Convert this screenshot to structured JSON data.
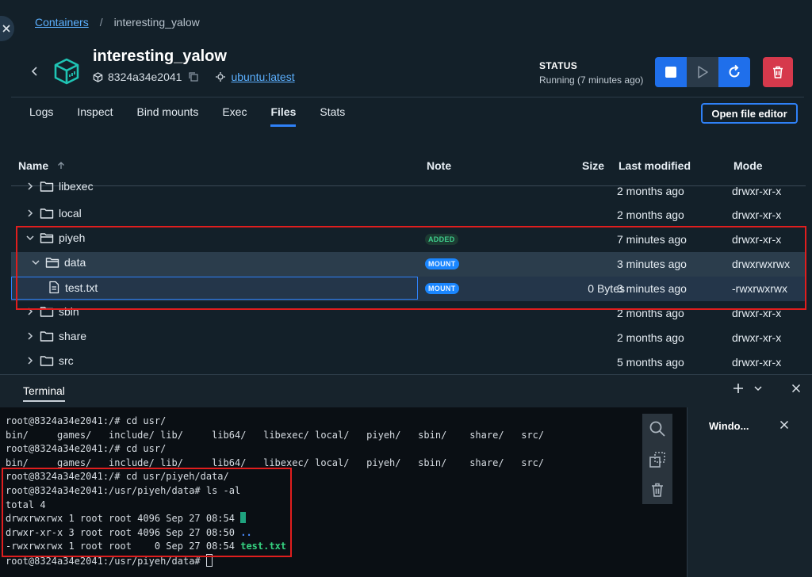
{
  "breadcrumb": {
    "root": "Containers",
    "separator": "/",
    "current": "interesting_yalow"
  },
  "container": {
    "name": "interesting_yalow",
    "id": "8324a34e2041",
    "image": "ubuntu:latest"
  },
  "status": {
    "label": "STATUS",
    "value": "Running (7 minutes ago)"
  },
  "tabs": [
    "Logs",
    "Inspect",
    "Bind mounts",
    "Exec",
    "Files",
    "Stats"
  ],
  "active_tab": "Files",
  "open_editor_label": "Open file editor",
  "table": {
    "headers": {
      "name": "Name",
      "note": "Note",
      "size": "Size",
      "modified": "Last modified",
      "mode": "Mode"
    },
    "rows": [
      {
        "name": "libexec",
        "note": "",
        "size": "",
        "modified": "2 months ago",
        "mode": "drwxr-xr-x"
      },
      {
        "name": "local",
        "note": "",
        "size": "",
        "modified": "2 months ago",
        "mode": "drwxr-xr-x"
      },
      {
        "name": "piyeh",
        "note": "ADDED",
        "size": "",
        "modified": "7 minutes ago",
        "mode": "drwxr-xr-x"
      },
      {
        "name": "data",
        "note": "MOUNT",
        "size": "",
        "modified": "3 minutes ago",
        "mode": "drwxrwxrwx"
      },
      {
        "name": "test.txt",
        "note": "MOUNT",
        "size": "0 Bytes",
        "modified": "3 minutes ago",
        "mode": "-rwxrwxrwx"
      },
      {
        "name": "sbin",
        "note": "",
        "size": "",
        "modified": "2 months ago",
        "mode": "drwxr-xr-x"
      },
      {
        "name": "share",
        "note": "",
        "size": "",
        "modified": "2 months ago",
        "mode": "drwxr-xr-x"
      },
      {
        "name": "src",
        "note": "",
        "size": "",
        "modified": "5 months ago",
        "mode": "drwxr-xr-x"
      }
    ]
  },
  "terminal": {
    "tab_label": "Terminal",
    "lines": [
      "root@8324a34e2041:/# cd usr/",
      "bin/     games/   include/ lib/     lib64/   libexec/ local/   piyeh/   sbin/    share/   src/",
      "root@8324a34e2041:/# cd usr/",
      "bin/     games/   include/ lib/     lib64/   libexec/ local/   piyeh/   sbin/    share/   src/",
      "root@8324a34e2041:/# cd usr/piyeh/data/",
      "root@8324a34e2041:/usr/piyeh/data# ls -al",
      "total 4",
      "drwxrwxrwx 1 root root 4096 Sep 27 08:54 ",
      "drwxr-xr-x 3 root root 4096 Sep 27 08:50 ",
      "-rwxrwxrwx 1 root root    0 Sep 27 08:54 ",
      "root@8324a34e2041:/usr/piyeh/data# "
    ],
    "ls_names": {
      "dotdot": "..",
      "file": "test.txt"
    }
  },
  "side_panel": {
    "title": "Windo..."
  }
}
